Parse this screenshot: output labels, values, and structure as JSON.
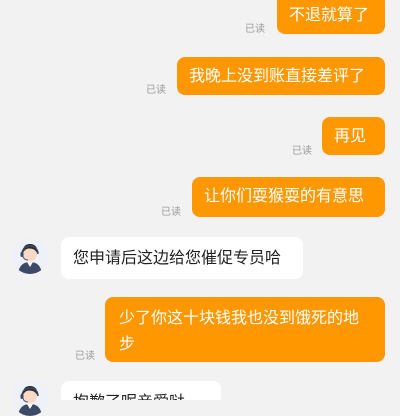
{
  "messages": {
    "m1": {
      "text": "不退就算了",
      "status": "已读"
    },
    "m2": {
      "text": "我晚上没到账直接差评了",
      "status": "已读"
    },
    "m3": {
      "text": "再见",
      "status": "已读"
    },
    "m4": {
      "text": "让你们耍猴耍的有意思",
      "status": "已读"
    },
    "m5": {
      "text": "您申请后这边给您催促专员哈",
      "avatar": "agent-avatar-icon"
    },
    "m6": {
      "text": "少了你这十块钱我也没到饿死的地步",
      "status": "已读"
    },
    "m7": {
      "text": "抱歉了呢亲爱哒",
      "avatar": "agent-avatar-icon"
    }
  },
  "colors": {
    "background": "#f2f2f2",
    "outgoing_bubble": "#ff9800",
    "incoming_bubble": "#ffffff",
    "read_status": "#9a9a9a"
  }
}
